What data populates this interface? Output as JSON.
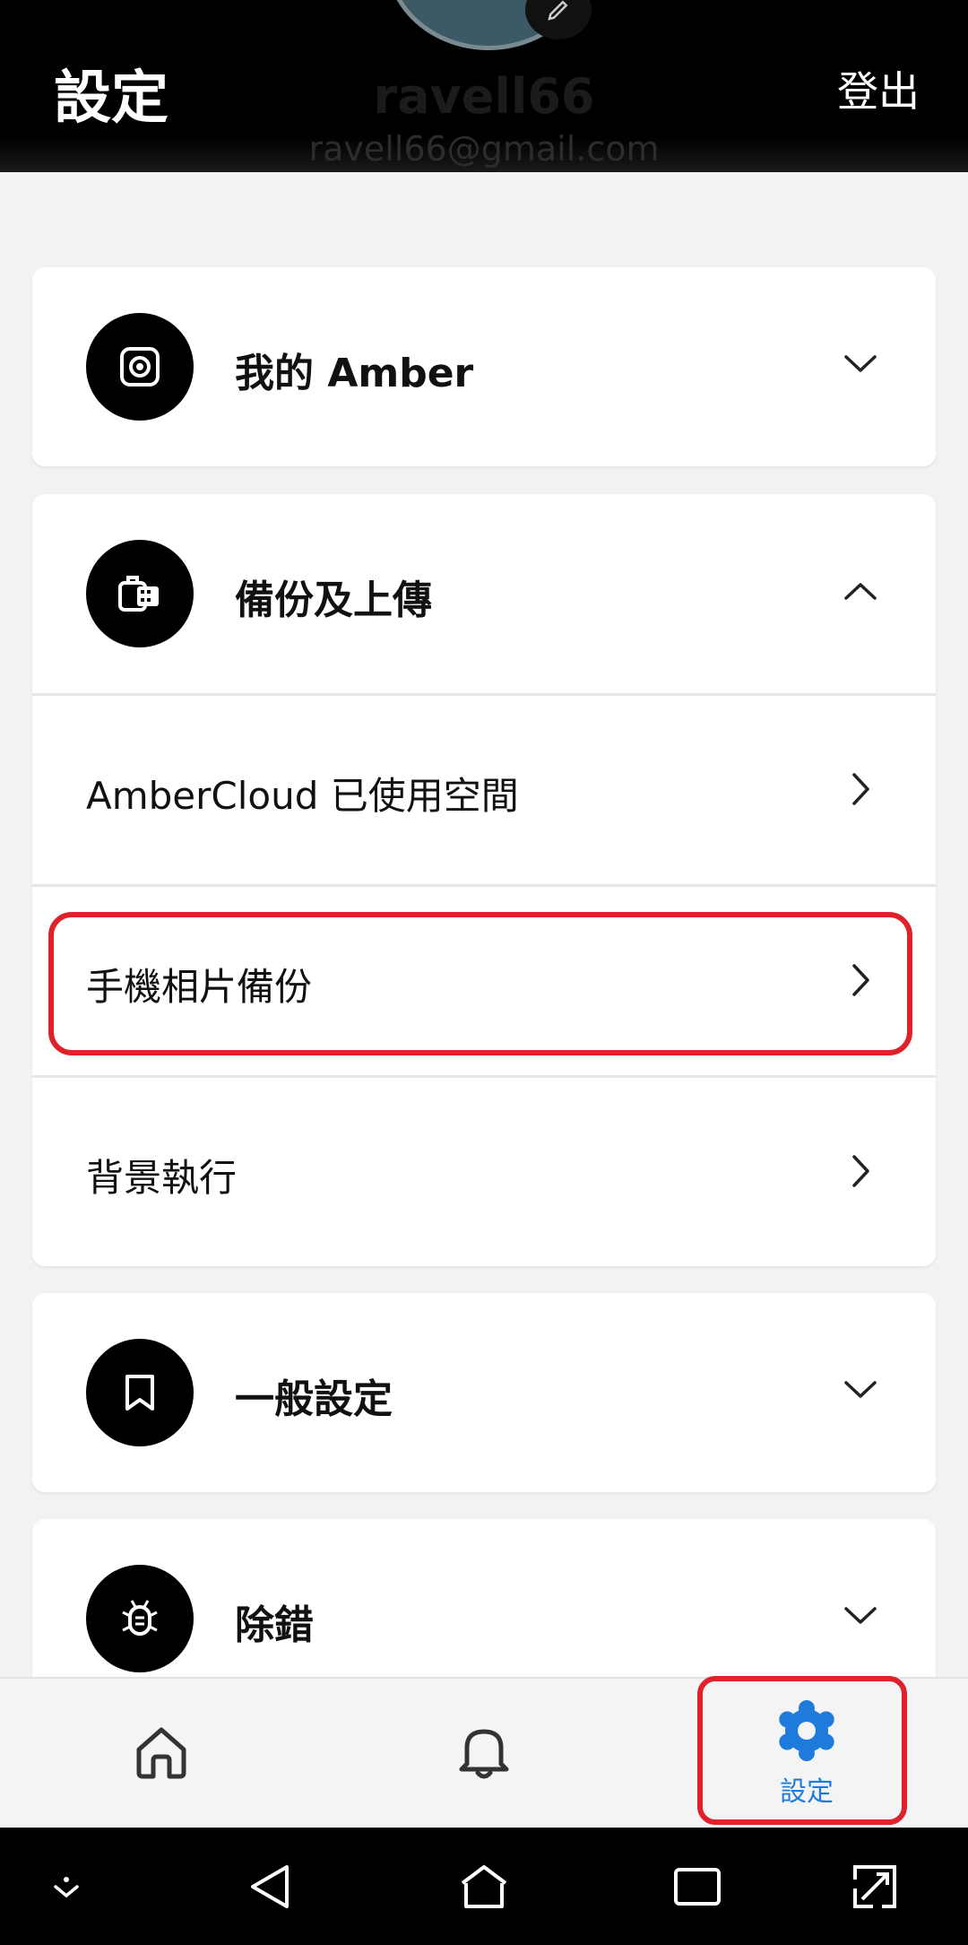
{
  "header": {
    "title": "設定",
    "logout_label": "登出",
    "profile_name": "ravell66",
    "profile_email": "ravell66@gmail.com"
  },
  "sections": {
    "my_amber": {
      "title": "我的 Amber",
      "icon": "amber-device-icon",
      "expanded": false
    },
    "backup": {
      "title": "備份及上傳",
      "icon": "backup-upload-icon",
      "expanded": true,
      "items": [
        {
          "label": "AmberCloud 已使用空間"
        },
        {
          "label": "手機相片備份"
        },
        {
          "label": "背景執行"
        }
      ]
    },
    "general": {
      "title": "一般設定",
      "icon": "bookmark-icon",
      "expanded": false
    },
    "debug": {
      "title": "除錯",
      "icon": "bug-icon",
      "expanded": false
    }
  },
  "bottom_nav": {
    "items": [
      {
        "name": "home",
        "icon": "home-icon",
        "label": ""
      },
      {
        "name": "notifications",
        "icon": "bell-icon",
        "label": ""
      },
      {
        "name": "settings",
        "icon": "gear-icon",
        "label": "設定",
        "active": true
      }
    ],
    "active_color": "#1e7bdc"
  },
  "highlight_color": "#e0212c"
}
